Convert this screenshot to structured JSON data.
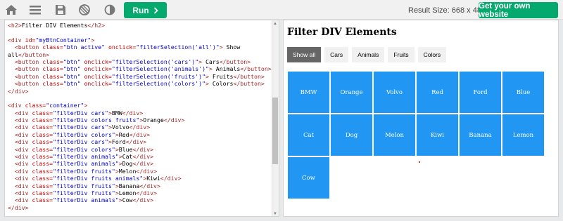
{
  "toolbar": {
    "icons": [
      "home-icon",
      "menu-icon",
      "save-icon",
      "orientation-icon",
      "theme-icon"
    ],
    "run_label": "Run",
    "result_size_label": "Result Size: 668 x 488",
    "own_site_label": "Get your own website"
  },
  "code_lines": [
    [
      [
        "t-tag",
        "<h2>"
      ],
      [
        "t-txt",
        "Filter DIV Elements"
      ],
      [
        "t-tag",
        "</h2>"
      ]
    ],
    [],
    [
      [
        "t-tag",
        "<div "
      ],
      [
        "t-attr",
        "id="
      ],
      [
        "t-val",
        "\"myBtnContainer\""
      ],
      [
        "t-tag",
        ">"
      ]
    ],
    [
      [
        "t-txt",
        "  "
      ],
      [
        "t-tag",
        "<button "
      ],
      [
        "t-attr",
        "class="
      ],
      [
        "t-val",
        "\"btn active\""
      ],
      [
        "t-attr",
        " onclick="
      ],
      [
        "t-val",
        "\"filterSelection('all')\""
      ],
      [
        "t-tag",
        "> "
      ],
      [
        "t-txt",
        "Show"
      ]
    ],
    [
      [
        "t-txt",
        "all"
      ],
      [
        "t-tag",
        "</button>"
      ]
    ],
    [
      [
        "t-txt",
        "  "
      ],
      [
        "t-tag",
        "<button "
      ],
      [
        "t-attr",
        "class="
      ],
      [
        "t-val",
        "\"btn\""
      ],
      [
        "t-attr",
        " onclick="
      ],
      [
        "t-val",
        "\"filterSelection('cars')\""
      ],
      [
        "t-tag",
        "> "
      ],
      [
        "t-txt",
        "Cars"
      ],
      [
        "t-tag",
        "</button>"
      ]
    ],
    [
      [
        "t-txt",
        "  "
      ],
      [
        "t-tag",
        "<button "
      ],
      [
        "t-attr",
        "class="
      ],
      [
        "t-val",
        "\"btn\""
      ],
      [
        "t-attr",
        " onclick="
      ],
      [
        "t-val",
        "\"filterSelection('animals')\""
      ],
      [
        "t-tag",
        "> "
      ],
      [
        "t-txt",
        "Animals"
      ],
      [
        "t-tag",
        "</button>"
      ]
    ],
    [
      [
        "t-txt",
        "  "
      ],
      [
        "t-tag",
        "<button "
      ],
      [
        "t-attr",
        "class="
      ],
      [
        "t-val",
        "\"btn\""
      ],
      [
        "t-attr",
        " onclick="
      ],
      [
        "t-val",
        "\"filterSelection('fruits')\""
      ],
      [
        "t-tag",
        "> "
      ],
      [
        "t-txt",
        "Fruits"
      ],
      [
        "t-tag",
        "</button>"
      ]
    ],
    [
      [
        "t-txt",
        "  "
      ],
      [
        "t-tag",
        "<button "
      ],
      [
        "t-attr",
        "class="
      ],
      [
        "t-val",
        "\"btn\""
      ],
      [
        "t-attr",
        " onclick="
      ],
      [
        "t-val",
        "\"filterSelection('colors')\""
      ],
      [
        "t-tag",
        "> "
      ],
      [
        "t-txt",
        "Colors"
      ],
      [
        "t-tag",
        "</button>"
      ]
    ],
    [
      [
        "t-tag",
        "</div>"
      ]
    ],
    [],
    [
      [
        "t-tag",
        "<div "
      ],
      [
        "t-attr",
        "class="
      ],
      [
        "t-val",
        "\"container\""
      ],
      [
        "t-tag",
        ">"
      ]
    ],
    [
      [
        "t-txt",
        "  "
      ],
      [
        "t-tag",
        "<div "
      ],
      [
        "t-attr",
        "class="
      ],
      [
        "t-val",
        "\"filterDiv cars\""
      ],
      [
        "t-tag",
        ">"
      ],
      [
        "t-txt",
        "BMW"
      ],
      [
        "t-tag",
        "</div>"
      ]
    ],
    [
      [
        "t-txt",
        "  "
      ],
      [
        "t-tag",
        "<div "
      ],
      [
        "t-attr",
        "class="
      ],
      [
        "t-val",
        "\"filterDiv colors fruits\""
      ],
      [
        "t-tag",
        ">"
      ],
      [
        "t-txt",
        "Orange"
      ],
      [
        "t-tag",
        "</div>"
      ]
    ],
    [
      [
        "t-txt",
        "  "
      ],
      [
        "t-tag",
        "<div "
      ],
      [
        "t-attr",
        "class="
      ],
      [
        "t-val",
        "\"filterDiv cars\""
      ],
      [
        "t-tag",
        ">"
      ],
      [
        "t-txt",
        "Volvo"
      ],
      [
        "t-tag",
        "</div>"
      ]
    ],
    [
      [
        "t-txt",
        "  "
      ],
      [
        "t-tag",
        "<div "
      ],
      [
        "t-attr",
        "class="
      ],
      [
        "t-val",
        "\"filterDiv colors\""
      ],
      [
        "t-tag",
        ">"
      ],
      [
        "t-txt",
        "Red"
      ],
      [
        "t-tag",
        "</div>"
      ]
    ],
    [
      [
        "t-txt",
        "  "
      ],
      [
        "t-tag",
        "<div "
      ],
      [
        "t-attr",
        "class="
      ],
      [
        "t-val",
        "\"filterDiv cars\""
      ],
      [
        "t-tag",
        ">"
      ],
      [
        "t-txt",
        "Ford"
      ],
      [
        "t-tag",
        "</div>"
      ]
    ],
    [
      [
        "t-txt",
        "  "
      ],
      [
        "t-tag",
        "<div "
      ],
      [
        "t-attr",
        "class="
      ],
      [
        "t-val",
        "\"filterDiv colors\""
      ],
      [
        "t-tag",
        ">"
      ],
      [
        "t-txt",
        "Blue"
      ],
      [
        "t-tag",
        "</div>"
      ]
    ],
    [
      [
        "t-txt",
        "  "
      ],
      [
        "t-tag",
        "<div "
      ],
      [
        "t-attr",
        "class="
      ],
      [
        "t-val",
        "\"filterDiv animals\""
      ],
      [
        "t-tag",
        ">"
      ],
      [
        "t-txt",
        "Cat"
      ],
      [
        "t-tag",
        "</div>"
      ]
    ],
    [
      [
        "t-txt",
        "  "
      ],
      [
        "t-tag",
        "<div "
      ],
      [
        "t-attr",
        "class="
      ],
      [
        "t-val",
        "\"filterDiv animals\""
      ],
      [
        "t-tag",
        ">"
      ],
      [
        "t-txt",
        "Dog"
      ],
      [
        "t-tag",
        "</div>"
      ]
    ],
    [
      [
        "t-txt",
        "  "
      ],
      [
        "t-tag",
        "<div "
      ],
      [
        "t-attr",
        "class="
      ],
      [
        "t-val",
        "\"filterDiv fruits\""
      ],
      [
        "t-tag",
        ">"
      ],
      [
        "t-txt",
        "Melon"
      ],
      [
        "t-tag",
        "</div>"
      ]
    ],
    [
      [
        "t-txt",
        "  "
      ],
      [
        "t-tag",
        "<div "
      ],
      [
        "t-attr",
        "class="
      ],
      [
        "t-val",
        "\"filterDiv fruits animals\""
      ],
      [
        "t-tag",
        ">"
      ],
      [
        "t-txt",
        "Kiwi"
      ],
      [
        "t-tag",
        "</div>"
      ]
    ],
    [
      [
        "t-txt",
        "  "
      ],
      [
        "t-tag",
        "<div "
      ],
      [
        "t-attr",
        "class="
      ],
      [
        "t-val",
        "\"filterDiv fruits\""
      ],
      [
        "t-tag",
        ">"
      ],
      [
        "t-txt",
        "Banana"
      ],
      [
        "t-tag",
        "</div>"
      ]
    ],
    [
      [
        "t-txt",
        "  "
      ],
      [
        "t-tag",
        "<div "
      ],
      [
        "t-attr",
        "class="
      ],
      [
        "t-val",
        "\"filterDiv fruits\""
      ],
      [
        "t-tag",
        ">"
      ],
      [
        "t-txt",
        "Lemon"
      ],
      [
        "t-tag",
        "</div>"
      ]
    ],
    [
      [
        "t-txt",
        "  "
      ],
      [
        "t-tag",
        "<div "
      ],
      [
        "t-attr",
        "class="
      ],
      [
        "t-val",
        "\"filterDiv animals\""
      ],
      [
        "t-tag",
        ">"
      ],
      [
        "t-txt",
        "Cow"
      ],
      [
        "t-tag",
        "</div>"
      ]
    ],
    [
      [
        "t-tag",
        "</div>"
      ]
    ]
  ],
  "result": {
    "title": "Filter DIV Elements",
    "buttons": [
      {
        "label": "Show all",
        "active": true
      },
      {
        "label": "Cars",
        "active": false
      },
      {
        "label": "Animals",
        "active": false
      },
      {
        "label": "Fruits",
        "active": false
      },
      {
        "label": "Colors",
        "active": false
      }
    ],
    "items": [
      "BMW",
      "Orange",
      "Volvo",
      "Red",
      "Ford",
      "Blue",
      "Cat",
      "Dog",
      "Melon",
      "Kiwi",
      "Banana",
      "Lemon",
      "Cow"
    ]
  }
}
